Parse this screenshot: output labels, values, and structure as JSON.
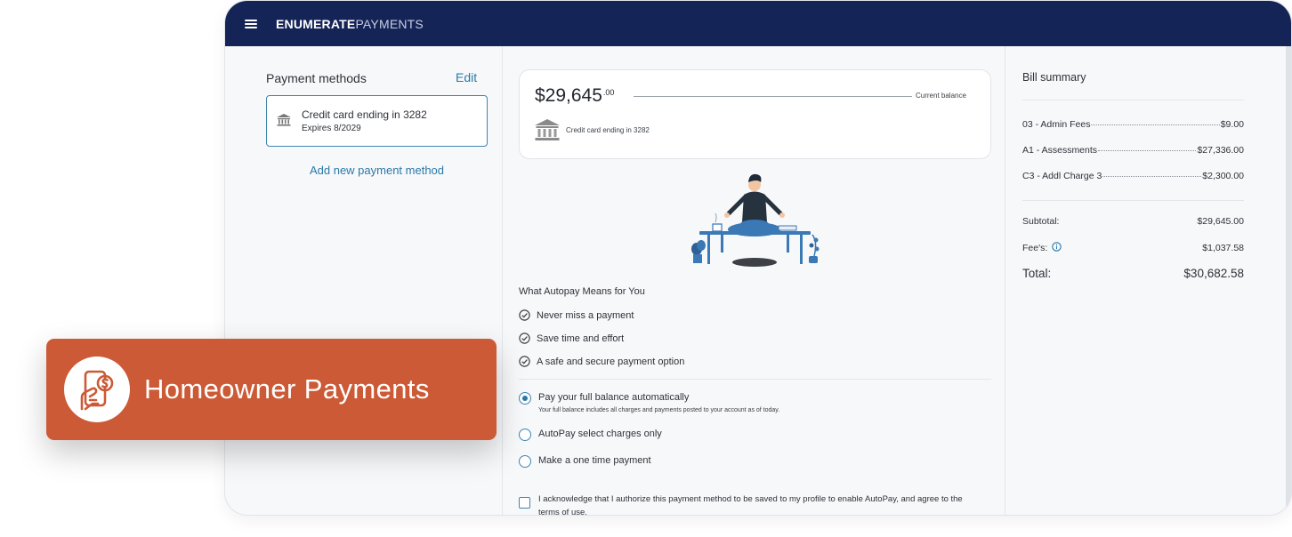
{
  "app": {
    "brand_bold": "ENUMERATE",
    "brand_light": "PAYMENTS"
  },
  "payment_methods": {
    "title": "Payment methods",
    "edit_label": "Edit",
    "card_title": "Credit card ending in 3282",
    "card_expiry": "Expires 8/2029",
    "add_label": "Add new payment method"
  },
  "balance": {
    "amount": "$29,645",
    "cents": ".00",
    "label": "Current balance",
    "card": "Credit card ending in 3282"
  },
  "autopay": {
    "title": "What Autopay Means for You",
    "benefits": [
      "Never miss a payment",
      "Save time and effort",
      "A safe and secure payment option"
    ],
    "options": [
      {
        "label": "Pay your full balance automatically",
        "sub": "Your full balance includes all charges and payments posted to your account as of today.",
        "selected": true
      },
      {
        "label": "AutoPay select charges only",
        "selected": false
      },
      {
        "label": "Make a one time payment",
        "selected": false
      }
    ],
    "acknowledge": "I acknowledge that I authorize this payment method to be saved to my profile to enable AutoPay, and agree to the terms of use."
  },
  "bill_summary": {
    "title": "Bill summary",
    "items": [
      {
        "name": "03 - Admin Fees",
        "amount": "$9.00"
      },
      {
        "name": "A1 - Assessments",
        "amount": "$27,336.00"
      },
      {
        "name": "C3 - Addl Charge 3",
        "amount": "$2,300.00"
      }
    ],
    "subtotal_label": "Subtotal:",
    "subtotal": "$29,645.00",
    "fees_label": "Fee's:",
    "fees": "$1,037.58",
    "total_label": "Total:",
    "total": "$30,682.58"
  },
  "badge": {
    "label": "Homeowner Payments"
  },
  "colors": {
    "navbar": "#152456",
    "accent": "#2b79a8",
    "badge": "#cc5a36"
  },
  "icons": [
    "menu-icon",
    "bank-icon",
    "check-circle-icon",
    "info-icon",
    "mobile-payment-icon"
  ]
}
